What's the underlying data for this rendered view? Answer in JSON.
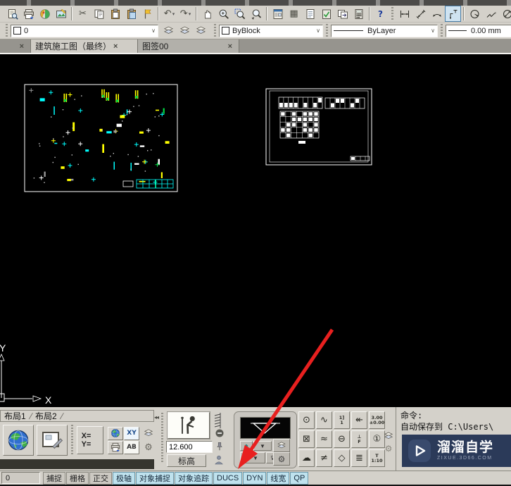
{
  "toolbar_main": {
    "items": [
      {
        "name": "preview",
        "k": "s",
        "s": "doc"
      },
      {
        "name": "plot",
        "k": "s",
        "s": "printer"
      },
      {
        "name": "render",
        "k": "s",
        "s": "sphere"
      },
      {
        "name": "image-edit",
        "k": "s",
        "s": "img"
      },
      {
        "k": "sep"
      },
      {
        "name": "cut",
        "k": "g",
        "g": "✂"
      },
      {
        "name": "copy",
        "k": "s",
        "s": "copy"
      },
      {
        "name": "paste",
        "k": "s",
        "s": "paste"
      },
      {
        "name": "paste-special",
        "k": "s",
        "s": "paste2"
      },
      {
        "name": "match-properties",
        "k": "s",
        "s": "flag"
      },
      {
        "k": "sep"
      },
      {
        "name": "undo",
        "k": "g",
        "g": "↶",
        "caret": true
      },
      {
        "name": "redo",
        "k": "g",
        "g": "↷",
        "caret": true
      },
      {
        "k": "sep"
      },
      {
        "name": "pan",
        "k": "s",
        "s": "hand"
      },
      {
        "name": "zoom-realtime",
        "k": "s",
        "s": "magp"
      },
      {
        "name": "zoom-window",
        "k": "s",
        "s": "magw"
      },
      {
        "name": "zoom-previous",
        "k": "s",
        "s": "magv"
      },
      {
        "k": "sep"
      },
      {
        "name": "properties-palette",
        "k": "s",
        "s": "props"
      },
      {
        "name": "design-center",
        "k": "g",
        "g": "▦"
      },
      {
        "name": "sheet-set-manager",
        "k": "s",
        "s": "sheet"
      },
      {
        "name": "markup-set-manager",
        "k": "s",
        "s": "markup"
      },
      {
        "name": "publish",
        "k": "s",
        "s": "pub"
      },
      {
        "name": "quick-calc",
        "k": "s",
        "s": "calc"
      },
      {
        "k": "sep"
      },
      {
        "name": "help",
        "k": "g",
        "g": "?",
        "cls": "help"
      },
      {
        "k": "grip"
      },
      {
        "name": "dim-linear",
        "k": "s",
        "s": "dlin"
      },
      {
        "name": "dim-aligned",
        "k": "s",
        "s": "dali"
      },
      {
        "name": "dim-arc-length",
        "k": "s",
        "s": "darc"
      },
      {
        "name": "dim-ordinate",
        "k": "s",
        "s": "dord",
        "sel": true
      },
      {
        "k": "sep"
      },
      {
        "name": "dim-radius",
        "k": "s",
        "s": "drad"
      },
      {
        "name": "dim-jogged",
        "k": "s",
        "s": "djog"
      },
      {
        "name": "dim-diameter",
        "k": "s",
        "s": "ddia"
      }
    ]
  },
  "properties_bar": {
    "layer_value": "0",
    "layer_tools": [
      "layer-properties-manager",
      "layer-previous",
      "layer-states-manager"
    ],
    "color_value": "ByBlock",
    "linetype_value": "ByLayer",
    "lineweight_value": "0.00 mm"
  },
  "file_tabs": {
    "close_glyph": "×",
    "tabs": [
      {
        "label": "",
        "active": false
      },
      {
        "label": "建筑施工图（最终）",
        "active": true
      },
      {
        "label": "图签00",
        "active": false
      }
    ]
  },
  "canvas": {
    "ucs": {
      "x_label": "X",
      "y_label": "Y"
    },
    "drawing1": {
      "palette": [
        "#ffff00",
        "#00ffff",
        "#ffffff",
        "#00dd44",
        "#9a9a9a"
      ]
    },
    "arrow_color": "#e8201f"
  },
  "bottom": {
    "layout_tabs": [
      "布局1",
      "布局2"
    ],
    "collapse_glyph": "◂◂",
    "elevation": {
      "value": "12.600",
      "label": "标高"
    },
    "xy_button": {
      "line1": "X=",
      "line2": "Y="
    },
    "cell_xy": "XY",
    "cell_ab": "AB",
    "tool_grid": [
      {
        "name": "coordinate-dim",
        "g": "⊙"
      },
      {
        "name": "wave-line",
        "g": "∿"
      },
      {
        "name": "index-pointer",
        "lines": [
          "1]",
          "1"
        ]
      },
      {
        "name": "arrow-leader",
        "g": "↞"
      },
      {
        "name": "elevation-symbol",
        "lines": [
          "3.00",
          "±0.00"
        ]
      },
      {
        "name": "section-cut",
        "g": "⊠"
      },
      {
        "name": "double-wave",
        "g": "≈"
      },
      {
        "name": "pipe-break",
        "g": "⊖"
      },
      {
        "name": "updown-leader",
        "lines": [
          "⊥",
          "F"
        ]
      },
      {
        "name": "axis-number",
        "g": "①"
      },
      {
        "name": "revision-cloud",
        "g": "☁"
      },
      {
        "name": "break-mark",
        "g": "≠"
      },
      {
        "name": "diamond-dim",
        "g": "◇"
      },
      {
        "name": "multi-leader",
        "g": "≣"
      },
      {
        "name": "text-scale",
        "lines": [
          "T",
          "1:10"
        ]
      }
    ],
    "command": {
      "line1": "命令:",
      "line2": "自动保存到 C:\\Users\\"
    }
  },
  "watermark": {
    "title": "溜溜自学",
    "subtitle": "ZIXUE.3D66.COM",
    "bg": "#2b3a59"
  },
  "statusbar": {
    "coord": "0",
    "buttons": [
      {
        "label": "捕捉",
        "on": false
      },
      {
        "label": "栅格",
        "on": false
      },
      {
        "label": "正交",
        "on": false
      },
      {
        "label": "极轴",
        "on": true
      },
      {
        "label": "对象捕捉",
        "on": true
      },
      {
        "label": "对象追踪",
        "on": true
      },
      {
        "label": "DUCS",
        "on": true
      },
      {
        "label": "DYN",
        "on": true
      },
      {
        "label": "线宽",
        "on": true
      },
      {
        "label": "QP",
        "on": true
      }
    ]
  }
}
